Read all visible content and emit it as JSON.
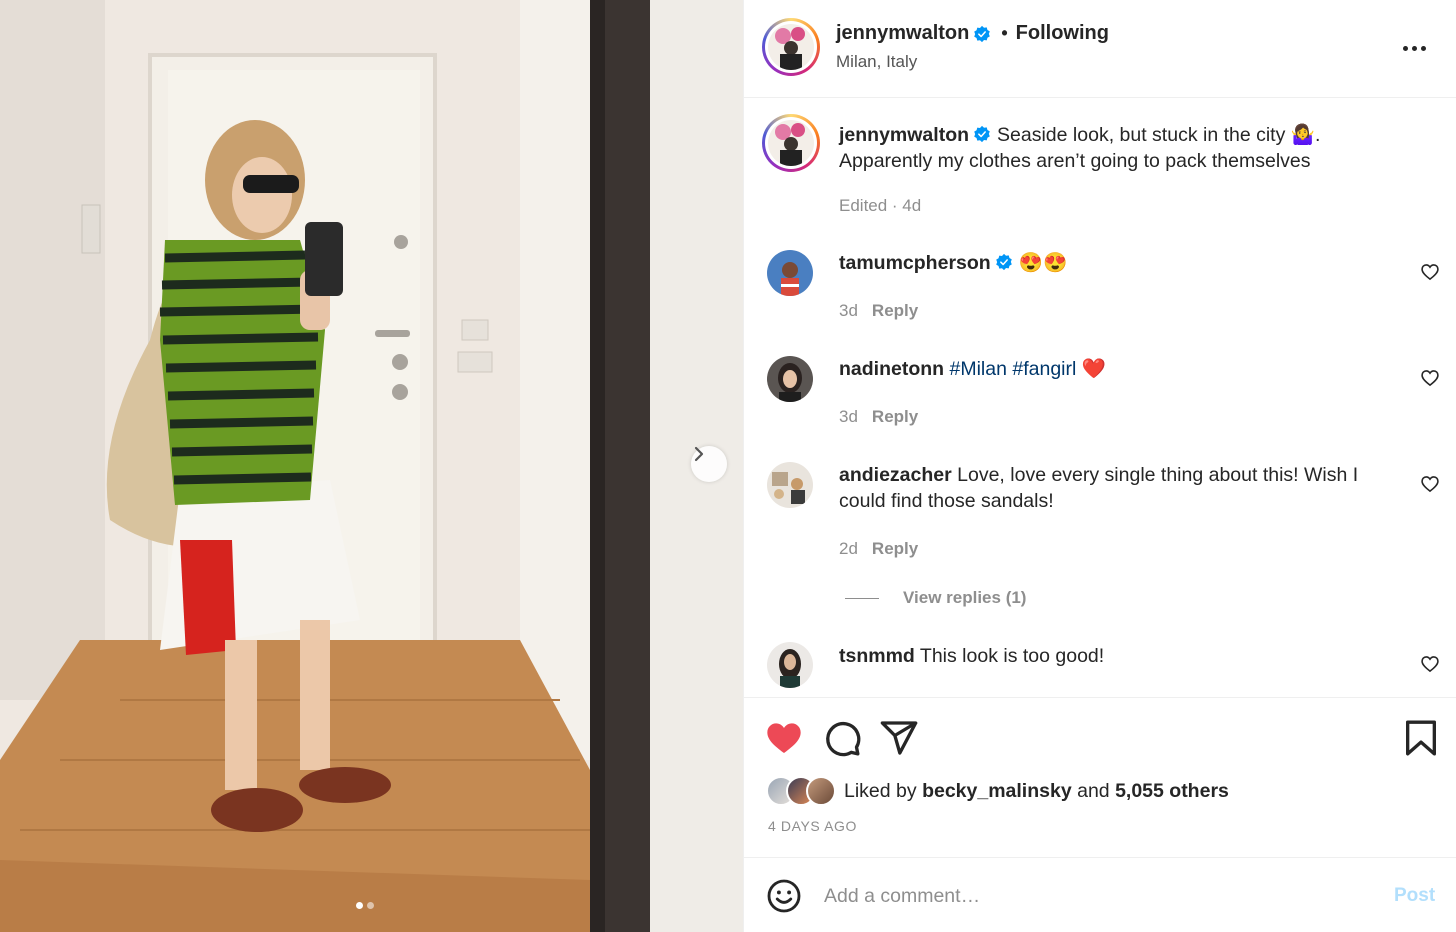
{
  "post": {
    "author": "jennymwalton",
    "follow_label": "Following",
    "separator": "•",
    "location": "Milan, Italy",
    "media_slides": 2,
    "active_slide": 1
  },
  "caption": {
    "author": "jennymwalton",
    "text": "Seaside look, but stuck in the city 🤷‍♀️. Apparently my clothes aren’t going to pack themselves",
    "meta": "Edited · 4d"
  },
  "comments": [
    {
      "user": "tamumcpherson",
      "verified": true,
      "text": "😍😍",
      "age": "3d",
      "reply_label": "Reply"
    },
    {
      "user": "nadinetonn",
      "verified": false,
      "text_parts": [
        "#Milan",
        "#fangirl",
        "❤️"
      ],
      "age": "3d",
      "reply_label": "Reply"
    },
    {
      "user": "andiezacher",
      "verified": false,
      "text": "Love, love every single thing about this! Wish I could find those sandals!",
      "age": "2d",
      "reply_label": "Reply"
    },
    {
      "user": "tsnmmd",
      "verified": false,
      "text": "This look is too good!"
    }
  ],
  "view_replies": "View replies (1)",
  "likes": {
    "prefix": "Liked by",
    "first_user": "becky_malinsky",
    "connector": "and",
    "others": "5,055 others"
  },
  "time_ago": "4 DAYS AGO",
  "comment_box": {
    "placeholder": "Add a comment…",
    "post_label": "Post"
  },
  "colors": {
    "like_red": "#ed4956",
    "verified_blue": "#0095f6",
    "post_disabled": "#b2dffc",
    "hashtag": "#00376b"
  },
  "icons": [
    "verified-badge-icon",
    "more-options-icon",
    "heart-outline-icon",
    "heart-filled-icon",
    "comment-icon",
    "share-icon",
    "bookmark-icon",
    "emoji-icon",
    "chevron-right-icon"
  ]
}
